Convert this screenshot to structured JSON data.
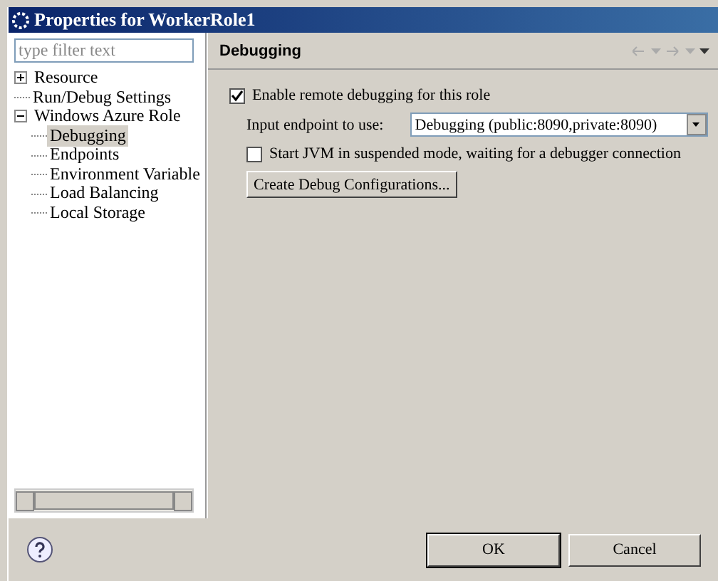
{
  "window": {
    "title": "Properties for WorkerRole1"
  },
  "filter": {
    "placeholder": "type filter text"
  },
  "tree": [
    {
      "label": "Resource",
      "expanded": false,
      "selected": false
    },
    {
      "label": "Run/Debug Settings",
      "selected": false
    },
    {
      "label": "Windows Azure Role",
      "expanded": true,
      "selected": false,
      "children": [
        {
          "label": "Debugging",
          "selected": true
        },
        {
          "label": "Endpoints",
          "selected": false
        },
        {
          "label": "Environment Variable",
          "selected": false
        },
        {
          "label": "Load Balancing",
          "selected": false
        },
        {
          "label": "Local Storage",
          "selected": false
        }
      ]
    }
  ],
  "page": {
    "title": "Debugging",
    "enable": {
      "label": "Enable remote debugging for this role",
      "checked": true
    },
    "endpoint": {
      "label": "Input endpoint to use:",
      "value": "Debugging (public:8090,private:8090)"
    },
    "suspend": {
      "label": "Start JVM in suspended mode, waiting for a debugger connection",
      "checked": false
    },
    "create_button": "Create Debug Configurations..."
  },
  "buttons": [
    {
      "label": "OK",
      "default": true
    },
    {
      "label": "Cancel",
      "default": false
    }
  ]
}
